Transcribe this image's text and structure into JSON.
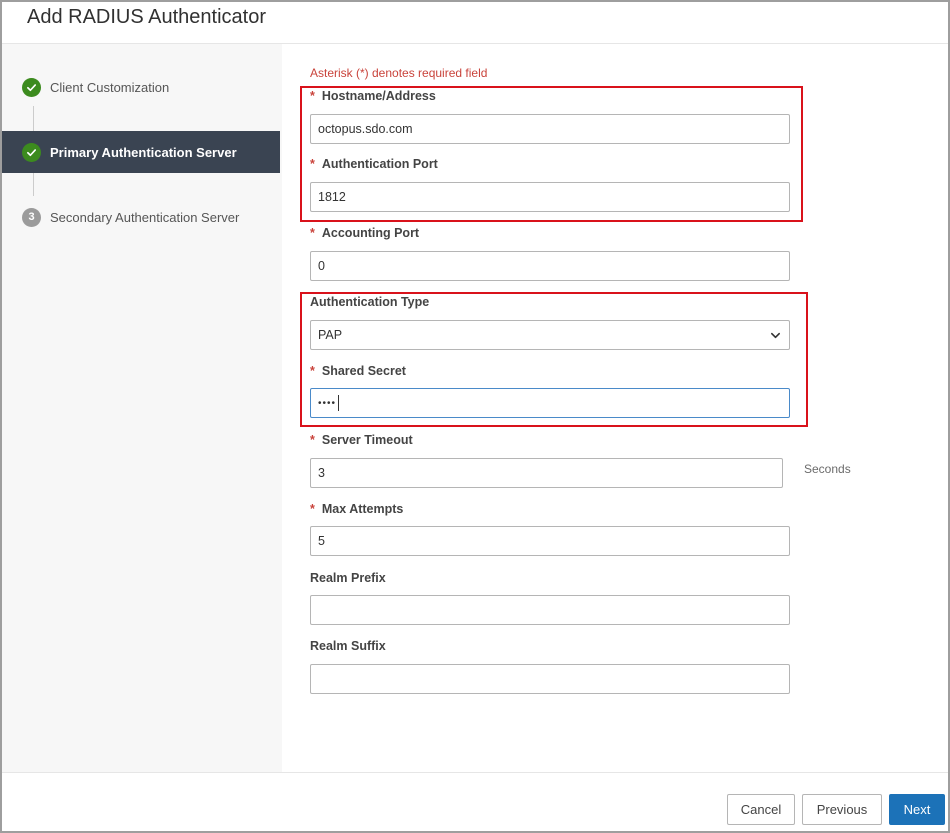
{
  "dialog": {
    "title": "Add RADIUS Authenticator"
  },
  "steps": [
    {
      "label": "Client Customization",
      "state": "done"
    },
    {
      "label": "Primary Authentication Server",
      "state": "active"
    },
    {
      "label": "Secondary Authentication Server",
      "state": "pending",
      "number": "3"
    }
  ],
  "form": {
    "required_note": "Asterisk (*) denotes required field",
    "required_marker": "*",
    "hostname": {
      "label": "Hostname/Address",
      "value": "octopus.sdo.com"
    },
    "auth_port": {
      "label": "Authentication Port",
      "value": "1812"
    },
    "accounting_port": {
      "label": "Accounting Port",
      "value": "0"
    },
    "auth_type": {
      "label": "Authentication Type",
      "value": "PAP"
    },
    "shared_secret": {
      "label": "Shared Secret",
      "value": "••••"
    },
    "server_timeout": {
      "label": "Server Timeout",
      "value": "3",
      "units": "Seconds"
    },
    "max_attempts": {
      "label": "Max Attempts",
      "value": "5"
    },
    "realm_prefix": {
      "label": "Realm Prefix",
      "value": ""
    },
    "realm_suffix": {
      "label": "Realm Suffix",
      "value": ""
    }
  },
  "buttons": {
    "cancel": "Cancel",
    "previous": "Previous",
    "next": "Next"
  },
  "colors": {
    "accent": "#1c72b8",
    "done": "#3c8b1e",
    "active_step_bg": "#3a4452",
    "required": "#c9433b",
    "highlight": "#d9121b"
  },
  "icons": {
    "done": "check-icon",
    "dropdown": "chevron-down-icon"
  }
}
